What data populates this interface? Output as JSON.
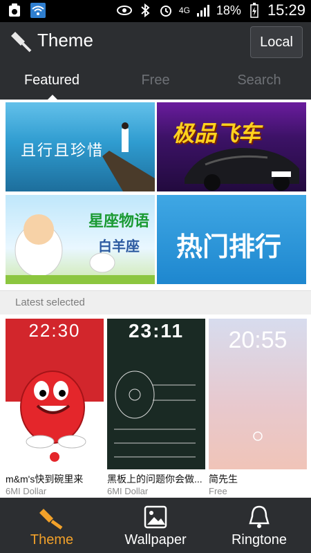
{
  "status_bar": {
    "battery": "18%",
    "network": "4G",
    "time": "15:29"
  },
  "header": {
    "title": "Theme",
    "local_button": "Local"
  },
  "tabs": [
    {
      "label": "Featured",
      "active": true
    },
    {
      "label": "Free",
      "active": false
    },
    {
      "label": "Search",
      "active": false
    }
  ],
  "banners": [
    {
      "text": "且行且珍惜"
    },
    {
      "text": "极品飞车"
    },
    {
      "text": "星座物语",
      "subtext": "白羊座"
    },
    {
      "text": "热门排行"
    }
  ],
  "section": {
    "title": "Latest selected"
  },
  "items": [
    {
      "name": "m&m's快到碗里来",
      "price": "6MI Dollar",
      "clock": "22:30"
    },
    {
      "name": "黑板上的问题你会做...",
      "price": "6MI Dollar",
      "clock": "23:11"
    },
    {
      "name": "简先生",
      "price": "Free",
      "clock": "20:55"
    }
  ],
  "bottom_nav": [
    {
      "label": "Theme",
      "active": true
    },
    {
      "label": "Wallpaper",
      "active": false
    },
    {
      "label": "Ringtone",
      "active": false
    }
  ],
  "colors": {
    "bar_background": "#2c2e31",
    "active_accent": "#f2a12a",
    "status_background": "#000000"
  }
}
